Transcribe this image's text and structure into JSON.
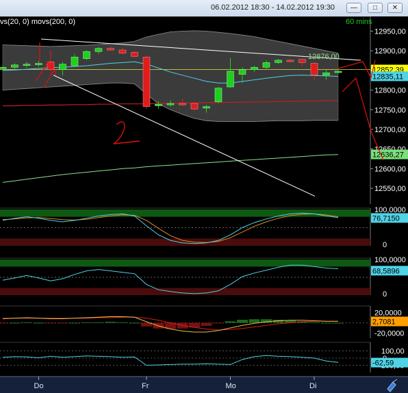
{
  "window": {
    "date_range": "06.02.2012 18:30 - 14.02.2012 19:30",
    "minimize_icon": "minimize-icon",
    "maximize_icon": "maximize-icon",
    "close_icon": "close-icon"
  },
  "chart_data": {
    "type": "candlestick",
    "legend_text": "vs(20, 0)  movs(200, 0)",
    "timeframe": "60 mins",
    "x_labels": [
      "Do",
      "Fr",
      "Mo",
      "Di"
    ],
    "price_panel": {
      "y_ticks": [
        12550,
        12600,
        12650,
        12700,
        12750,
        12800,
        12850,
        12900,
        12950
      ],
      "y_tick_labels": [
        "12550,00",
        "12600,00",
        "12650,00",
        "12700,00",
        "12750,00",
        "12800,00",
        "12850,00",
        "12900,00",
        "12950,00"
      ],
      "ylim": [
        12510,
        12970
      ],
      "value_tags": [
        {
          "text": "12852,39",
          "value": 12852.39,
          "color": "#ffff00",
          "text_color": "#000000"
        },
        {
          "text": "12835,11",
          "value": 12835.11,
          "color": "#4fd3e6",
          "text_color": "#000000"
        },
        {
          "text": "12636,27",
          "value": 12636.27,
          "color": "#79e07a",
          "text_color": "#000000"
        }
      ],
      "annotation": {
        "text": "12876,00",
        "value": 12876
      },
      "candles": [
        {
          "o": 12856,
          "h": 12862,
          "l": 12848,
          "c": 12858
        },
        {
          "o": 12858,
          "h": 12868,
          "l": 12854,
          "c": 12864
        },
        {
          "o": 12863,
          "h": 12872,
          "l": 12858,
          "c": 12866
        },
        {
          "o": 12866,
          "h": 12874,
          "l": 12860,
          "c": 12868
        },
        {
          "o": 12872,
          "h": 12900,
          "l": 12848,
          "c": 12852
        },
        {
          "o": 12852,
          "h": 12872,
          "l": 12838,
          "c": 12866
        },
        {
          "o": 12862,
          "h": 12892,
          "l": 12858,
          "c": 12884
        },
        {
          "o": 12880,
          "h": 12902,
          "l": 12876,
          "c": 12898
        },
        {
          "o": 12898,
          "h": 12910,
          "l": 12892,
          "c": 12906
        },
        {
          "o": 12906,
          "h": 12912,
          "l": 12900,
          "c": 12902
        },
        {
          "o": 12902,
          "h": 12908,
          "l": 12890,
          "c": 12894
        },
        {
          "o": 12896,
          "h": 12900,
          "l": 12884,
          "c": 12886
        },
        {
          "o": 12884,
          "h": 12888,
          "l": 12752,
          "c": 12758
        },
        {
          "o": 12760,
          "h": 12772,
          "l": 12752,
          "c": 12764
        },
        {
          "o": 12764,
          "h": 12774,
          "l": 12758,
          "c": 12766
        },
        {
          "o": 12766,
          "h": 12778,
          "l": 12760,
          "c": 12764
        },
        {
          "o": 12766,
          "h": 12770,
          "l": 12748,
          "c": 12752
        },
        {
          "o": 12754,
          "h": 12762,
          "l": 12742,
          "c": 12758
        },
        {
          "o": 12770,
          "h": 12808,
          "l": 12766,
          "c": 12805
        },
        {
          "o": 12808,
          "h": 12882,
          "l": 12806,
          "c": 12848
        },
        {
          "o": 12840,
          "h": 12858,
          "l": 12818,
          "c": 12852
        },
        {
          "o": 12852,
          "h": 12862,
          "l": 12846,
          "c": 12858
        },
        {
          "o": 12858,
          "h": 12876,
          "l": 12854,
          "c": 12870
        },
        {
          "o": 12870,
          "h": 12880,
          "l": 12866,
          "c": 12876
        },
        {
          "o": 12876,
          "h": 12880,
          "l": 12870,
          "c": 12874
        },
        {
          "o": 12878,
          "h": 12880,
          "l": 12860,
          "c": 12870
        },
        {
          "o": 12868,
          "h": 12872,
          "l": 12824,
          "c": 12838
        },
        {
          "o": 12838,
          "h": 12852,
          "l": 12826,
          "c": 12844
        },
        {
          "o": 12846,
          "h": 12852,
          "l": 12842,
          "c": 12848
        }
      ],
      "bb_upper": [
        12915,
        12914,
        12913,
        12912,
        12911,
        12912,
        12913,
        12914,
        12916,
        12918,
        12920,
        12924,
        12935,
        12942,
        12948,
        12950,
        12951,
        12950,
        12947,
        12944,
        12940,
        12936,
        12930,
        12924,
        12918,
        12912,
        12906,
        12900,
        12894
      ],
      "bb_lower": [
        12800,
        12802,
        12804,
        12806,
        12808,
        12810,
        12812,
        12814,
        12816,
        12818,
        12818,
        12816,
        12790,
        12765,
        12750,
        12738,
        12728,
        12722,
        12720,
        12720,
        12720,
        12720,
        12721,
        12722,
        12722,
        12722,
        12723,
        12723,
        12723
      ],
      "ma_cyan": [
        12850,
        12851,
        12853,
        12855,
        12857,
        12858,
        12860,
        12862,
        12865,
        12868,
        12870,
        12872,
        12866,
        12856,
        12846,
        12838,
        12830,
        12822,
        12818,
        12818,
        12822,
        12826,
        12830,
        12834,
        12837,
        12838,
        12837,
        12836,
        12835
      ],
      "ma_red": [
        12760,
        12760,
        12761,
        12761,
        12762,
        12762,
        12763,
        12763,
        12764,
        12764,
        12765,
        12765,
        12765,
        12766,
        12766,
        12767,
        12767,
        12768,
        12768,
        12769,
        12769,
        12770,
        12770,
        12771,
        12771,
        12772,
        12772,
        12773,
        12773
      ],
      "ma_green": [
        12565,
        12569,
        12573,
        12577,
        12581,
        12585,
        12588,
        12591,
        12594,
        12597,
        12600,
        12602,
        12605,
        12607,
        12609,
        12611,
        12613,
        12615,
        12617,
        12619,
        12621,
        12623,
        12625,
        12627,
        12629,
        12631,
        12633,
        12635,
        12636
      ],
      "horizontal_line": 12852.39
    },
    "stoch_panel": {
      "y_tick_labels": [
        "100,0000",
        "0"
      ],
      "ylim": [
        0,
        100
      ],
      "value_tag": {
        "text": "76,7150",
        "value": 76.715,
        "color": "#4fd3e6",
        "text_color": "#000000"
      },
      "k": [
        70,
        76,
        80,
        76,
        70,
        66,
        70,
        76,
        82,
        86,
        88,
        82,
        55,
        30,
        15,
        8,
        6,
        8,
        15,
        30,
        50,
        64,
        74,
        82,
        88,
        90,
        88,
        82,
        78
      ],
      "d": [
        72,
        74,
        77,
        78,
        75,
        72,
        71,
        73,
        78,
        82,
        85,
        84,
        70,
        48,
        28,
        15,
        10,
        9,
        12,
        22,
        38,
        54,
        66,
        76,
        83,
        87,
        88,
        85,
        80
      ]
    },
    "rsi_panel": {
      "y_tick_labels": [
        "100,0000",
        "0"
      ],
      "ylim": [
        0,
        100
      ],
      "value_tag": {
        "text": "68,5896",
        "value": 68.5896,
        "color": "#4fd3e6",
        "text_color": "#000000"
      },
      "values": [
        42,
        48,
        55,
        48,
        40,
        46,
        58,
        68,
        72,
        68,
        64,
        60,
        30,
        15,
        10,
        6,
        4,
        6,
        12,
        30,
        52,
        62,
        70,
        78,
        84,
        84,
        80,
        76,
        74
      ]
    },
    "macd_panel": {
      "y_tick_labels": [
        "20,0000",
        "-20,0000"
      ],
      "ylim": [
        -30,
        30
      ],
      "value_tag": {
        "text": "2,7081",
        "value": 2.7081,
        "color": "#ffa000",
        "text_color": "#000000"
      },
      "macd": [
        8,
        9,
        10,
        9,
        8,
        8,
        9,
        10,
        11,
        12,
        12,
        11,
        2,
        -6,
        -12,
        -16,
        -18,
        -18,
        -15,
        -10,
        -5,
        -1,
        2,
        4,
        5,
        5,
        4,
        3,
        3
      ],
      "signal": [
        9,
        9,
        9,
        9,
        9,
        9,
        9,
        9,
        10,
        10,
        11,
        11,
        9,
        5,
        0,
        -5,
        -9,
        -12,
        -14,
        -13,
        -11,
        -8,
        -5,
        -2,
        0,
        2,
        3,
        3,
        3
      ],
      "hist": [
        -1,
        0,
        1,
        0,
        -1,
        -1,
        0,
        1,
        1,
        2,
        1,
        0,
        -7,
        -11,
        -12,
        -11,
        -9,
        -6,
        -1,
        3,
        6,
        7,
        7,
        6,
        5,
        3,
        1,
        0,
        0
      ]
    },
    "cci_panel": {
      "y_tick_labels": [
        "100,00",
        "0",
        "-100,00"
      ],
      "ylim": [
        -200,
        200
      ],
      "value_tag": {
        "text": "-62,59",
        "value": -62.59,
        "color": "#4fd3e6",
        "text_color": "#000000"
      },
      "values": [
        10,
        20,
        15,
        5,
        25,
        10,
        20,
        30,
        25,
        20,
        10,
        15,
        -100,
        -95,
        -90,
        -85,
        -85,
        -80,
        -85,
        -90,
        -20,
        20,
        35,
        25,
        20,
        10,
        0,
        -40,
        -60
      ]
    }
  }
}
